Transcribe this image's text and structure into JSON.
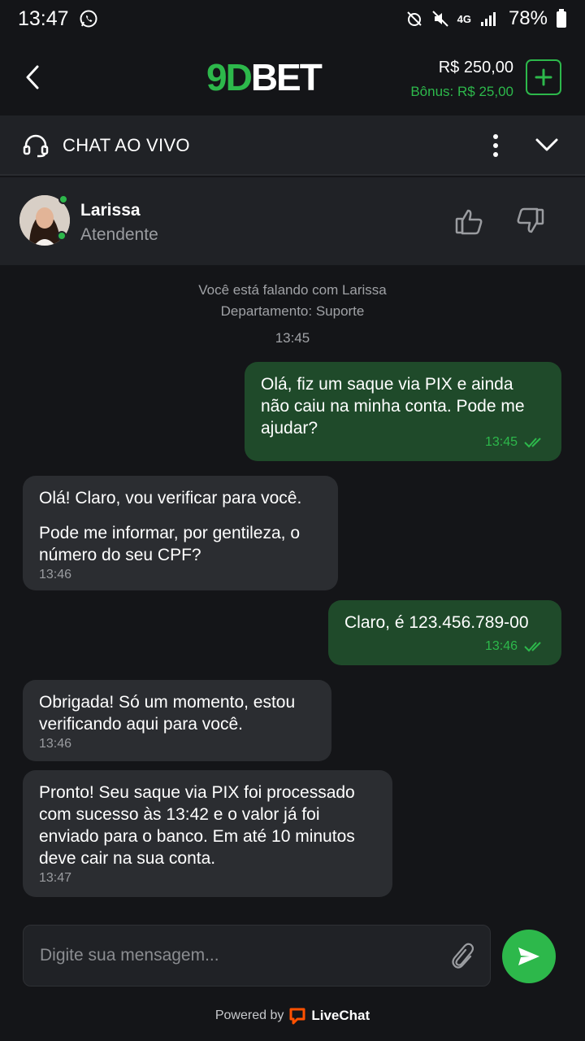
{
  "status": {
    "time": "13:47",
    "network": "4G",
    "battery": "78%"
  },
  "header": {
    "logo_green": "9D",
    "logo_white": "BET",
    "balance": "R$ 250,00",
    "bonus": "Bônus: R$ 25,00"
  },
  "chatbar": {
    "title": "CHAT AO VIVO"
  },
  "agent": {
    "name": "Larissa",
    "role": "Atendente"
  },
  "system": {
    "line1": "Você está falando com Larissa",
    "line2": "Departamento: Suporte",
    "time": "13:45"
  },
  "messages": [
    {
      "from": "user",
      "text": "Olá, fiz um saque via PIX e ainda não caiu na minha conta. Pode me ajudar?",
      "time": "13:45"
    },
    {
      "from": "agent",
      "text": "Olá! Claro, vou verificar para você.",
      "text2": "Pode me informar, por gentileza, o número do seu CPF?",
      "time": "13:46"
    },
    {
      "from": "user",
      "text": "Claro, é 123.456.789-00",
      "time": "13:46"
    },
    {
      "from": "agent",
      "text": "Obrigada! Só um momento, estou verificando aqui para você.",
      "time": "13:46"
    },
    {
      "from": "agent",
      "text": "Pronto! Seu saque via PIX foi processado com sucesso às 13:42 e o valor já foi enviado para o banco. Em até 10 minutos deve cair na sua conta.",
      "time": "13:47"
    }
  ],
  "composer": {
    "placeholder": "Digite sua mensagem..."
  },
  "footer": {
    "powered": "Powered by",
    "brand": "LiveChat"
  },
  "colors": {
    "accent": "#2db84b",
    "background": "#141518",
    "panel": "#202226",
    "user_bubble": "#1f4a2a",
    "agent_bubble": "#2b2d31"
  }
}
